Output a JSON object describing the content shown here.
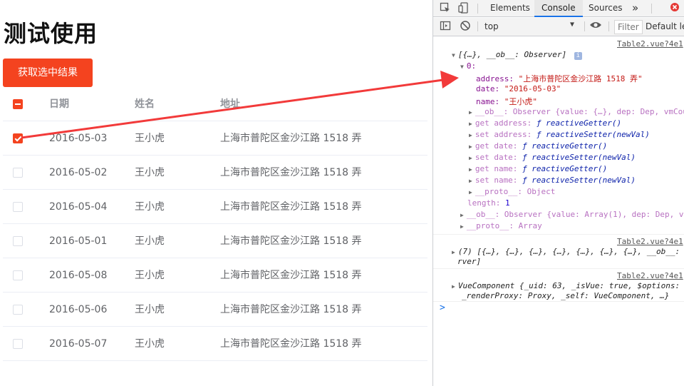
{
  "app": {
    "title": "测试使用",
    "button_label": "获取选中结果"
  },
  "table": {
    "headers": {
      "date": "日期",
      "name": "姓名",
      "address": "地址"
    },
    "rows": [
      {
        "date": "2016-05-03",
        "name": "王小虎",
        "address": "上海市普陀区金沙江路 1518 弄",
        "checked": true
      },
      {
        "date": "2016-05-02",
        "name": "王小虎",
        "address": "上海市普陀区金沙江路 1518 弄",
        "checked": false
      },
      {
        "date": "2016-05-04",
        "name": "王小虎",
        "address": "上海市普陀区金沙江路 1518 弄",
        "checked": false
      },
      {
        "date": "2016-05-01",
        "name": "王小虎",
        "address": "上海市普陀区金沙江路 1518 弄",
        "checked": false
      },
      {
        "date": "2016-05-08",
        "name": "王小虎",
        "address": "上海市普陀区金沙江路 1518 弄",
        "checked": false
      },
      {
        "date": "2016-05-06",
        "name": "王小虎",
        "address": "上海市普陀区金沙江路 1518 弄",
        "checked": false
      },
      {
        "date": "2016-05-07",
        "name": "王小虎",
        "address": "上海市普陀区金沙江路 1518 弄",
        "checked": false
      }
    ]
  },
  "devtools": {
    "tabs": [
      "Elements",
      "Console",
      "Sources"
    ],
    "active_tab": "Console",
    "more_tabs": "»",
    "context": "top",
    "filter_placeholder": "Filter",
    "levels": "Default lev",
    "console": {
      "src1": "Table2.vue?4e1",
      "array_header": "[{…}, __ob__: Observer]",
      "info_badge": "i",
      "idx0": "0:",
      "address_key": "address:",
      "address_val": "\"上海市普陀区金沙江路 1518 弄\"",
      "date_key": "date:",
      "date_val": "\"2016-05-03\"",
      "name_key": "name:",
      "name_val": "\"王小虎\"",
      "ob_line": "__ob__: Observer {value: {…}, dep: Dep, vmCou",
      "get_address": "get address:",
      "set_address": "set address:",
      "get_date": "get date:",
      "set_date": "set date:",
      "get_name": "get name:",
      "set_name": "set name:",
      "getter": "ƒ reactiveGetter()",
      "setter": "ƒ reactiveSetter(newVal)",
      "proto_obj": "__proto__: Object",
      "length_key": "length:",
      "length_val": "1",
      "ob_array": "__ob__: Observer {value: Array(1), dep: Dep, v",
      "proto_arr": "__proto__: Array",
      "src2": "Table2.vue?4e1",
      "seven_line1": "(7) [{…}, {…}, {…}, {…}, {…}, {…}, {…}, __ob__: O",
      "seven_line2": "rver]",
      "src3": "Table2.vue?4e1",
      "vc_line1": "VueComponent {_uid: 63, _isVue: true, $options:",
      "vc_line2": "_renderProxy: Proxy, _self: VueComponent, …}",
      "prompt": ">"
    }
  },
  "colors": {
    "accent": "#f4431f",
    "arrow": "#f23a3a"
  }
}
